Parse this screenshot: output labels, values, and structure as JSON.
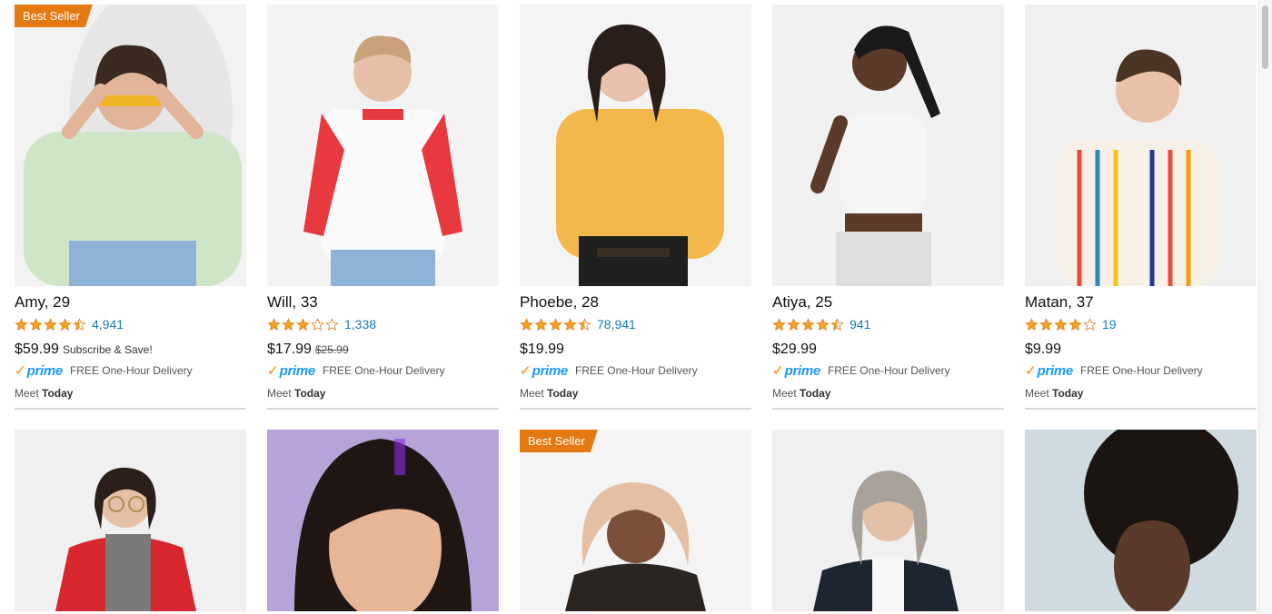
{
  "badge_label": "Best Seller",
  "colors": {
    "accent": "#e47911",
    "link": "#1a7bb9",
    "prime": "#1a98ff",
    "star": "#f4a41d"
  },
  "products": [
    {
      "name": "Amy, 29",
      "rating": 4.5,
      "reviews": "4,941",
      "price": "$59.99",
      "old_price": "",
      "note": "Subscribe & Save!",
      "prime_label": "prime",
      "delivery": "FREE One-Hour Delivery",
      "meet_prefix": "Meet",
      "meet_day": "Today",
      "best_seller": true
    },
    {
      "name": "Will, 33",
      "rating": 3,
      "reviews": "1,338",
      "price": "$17.99",
      "old_price": "$25.99",
      "note": "",
      "prime_label": "prime",
      "delivery": "FREE One-Hour Delivery",
      "meet_prefix": "Meet",
      "meet_day": "Today",
      "best_seller": false
    },
    {
      "name": "Phoebe, 28",
      "rating": 4.5,
      "reviews": "78,941",
      "price": "$19.99",
      "old_price": "",
      "note": "",
      "prime_label": "prime",
      "delivery": "FREE One-Hour Delivery",
      "meet_prefix": "Meet",
      "meet_day": "Today",
      "best_seller": false
    },
    {
      "name": "Atiya, 25",
      "rating": 4.5,
      "reviews": "941",
      "price": "$29.99",
      "old_price": "",
      "note": "",
      "prime_label": "prime",
      "delivery": "FREE One-Hour Delivery",
      "meet_prefix": "Meet",
      "meet_day": "Today",
      "best_seller": false
    },
    {
      "name": "Matan, 37",
      "rating": 4,
      "reviews": "19",
      "price": "$9.99",
      "old_price": "",
      "note": "",
      "prime_label": "prime",
      "delivery": "FREE One-Hour Delivery",
      "meet_prefix": "Meet",
      "meet_day": "Today",
      "best_seller": false
    }
  ],
  "second_row": [
    {
      "best_seller": false,
      "background": "#f0f0f0"
    },
    {
      "best_seller": false,
      "background": "#b7a3d8"
    },
    {
      "best_seller": true,
      "background": "#f4f4f4"
    },
    {
      "best_seller": false,
      "background": "#f0f0f0"
    },
    {
      "best_seller": false,
      "background": "#cfdbe0"
    }
  ]
}
